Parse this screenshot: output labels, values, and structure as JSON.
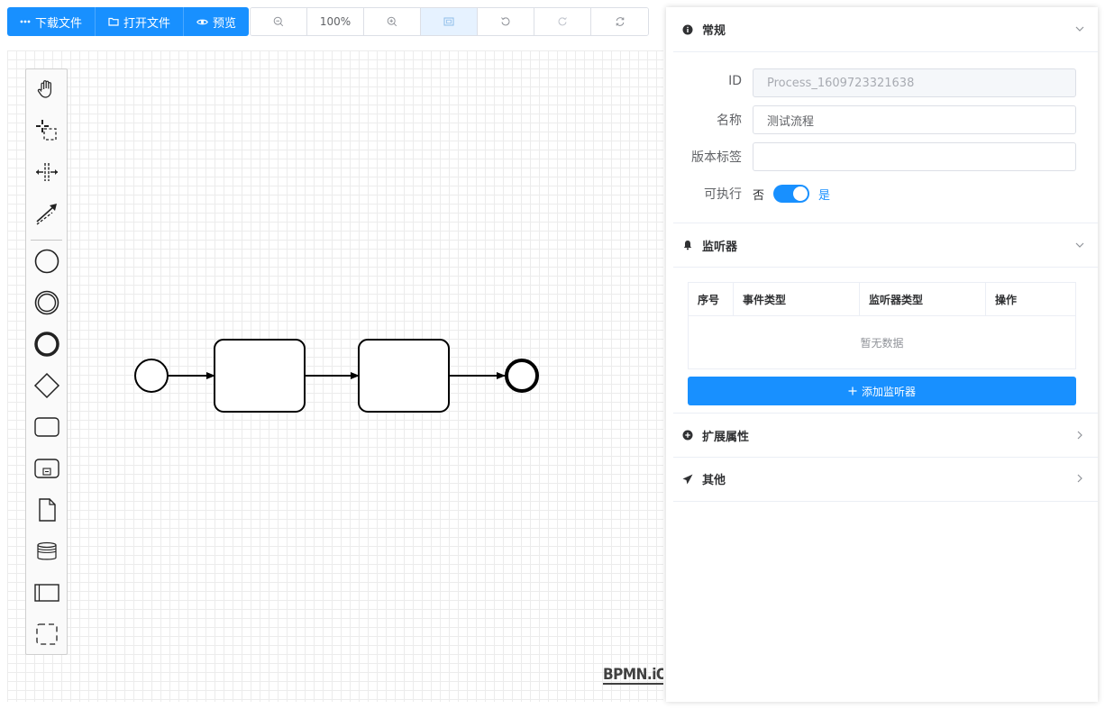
{
  "toolbar": {
    "download_label": "下载文件",
    "open_label": "打开文件",
    "preview_label": "预览",
    "zoom_level": "100%",
    "accent_color": "#1890ff"
  },
  "canvas": {
    "logo_text": "BPMN.iO"
  },
  "panel": {
    "general": {
      "title": "常规",
      "id_label": "ID",
      "id_value": "Process_1609723321638",
      "name_label": "名称",
      "name_value": "测试流程",
      "version_label": "版本标签",
      "version_value": "",
      "executable_label": "可执行",
      "switch_off_text": "否",
      "switch_on_text": "是",
      "executable": true
    },
    "listeners": {
      "title": "监听器",
      "columns": [
        "序号",
        "事件类型",
        "监听器类型",
        "操作"
      ],
      "empty_text": "暂无数据",
      "add_button": "添加监听器"
    },
    "extensions": {
      "title": "扩展属性"
    },
    "other": {
      "title": "其他"
    }
  }
}
